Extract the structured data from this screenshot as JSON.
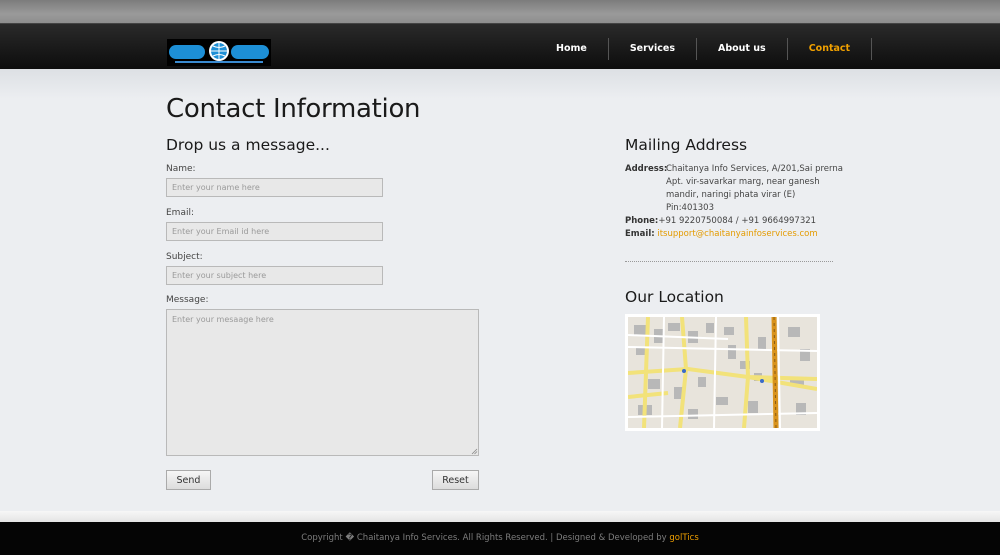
{
  "nav": {
    "logo_text": "CIS",
    "items": [
      {
        "label": "Home"
      },
      {
        "label": "Services"
      },
      {
        "label": "About us"
      },
      {
        "label": "Contact"
      }
    ],
    "active": "Contact"
  },
  "page_title": "Contact Information",
  "form": {
    "heading": "Drop us a message...",
    "name_label": "Name:",
    "name_placeholder": "Enter your name here",
    "email_label": "Email:",
    "email_placeholder": "Enter your Email id here",
    "subject_label": "Subject:",
    "subject_placeholder": "Enter your subject here",
    "message_label": "Message:",
    "message_placeholder": "Enter your mesaage here",
    "send_label": "Send",
    "reset_label": "Reset"
  },
  "mailing": {
    "heading": "Mailing Address",
    "address_label": "Address:",
    "address_lines": [
      "Chaitanya Info Services, A/201,Sai prerna",
      "Apt. vir-savarkar marg, near ganesh",
      "mandir, naringi phata virar (E)",
      "Pin:401303"
    ],
    "phone_label": "Phone:",
    "phone_value": "+91 9220750084 / +91 9664997321",
    "email_label": "Email:",
    "email_value": "itsupport@chaitanyainfoservices.com"
  },
  "location": {
    "heading": "Our Location"
  },
  "footer": {
    "copyright": "Copyright � Chaitanya Info Services. All Rights Reserved. | Designed & Developed by ",
    "developer": "golTics"
  },
  "colors": {
    "accent": "#f0a000",
    "link": "#e49b00",
    "navbar": "#111111",
    "page_bg": "#eceef1"
  },
  "icons": {
    "textarea_resize": "resize-grip-icon"
  }
}
